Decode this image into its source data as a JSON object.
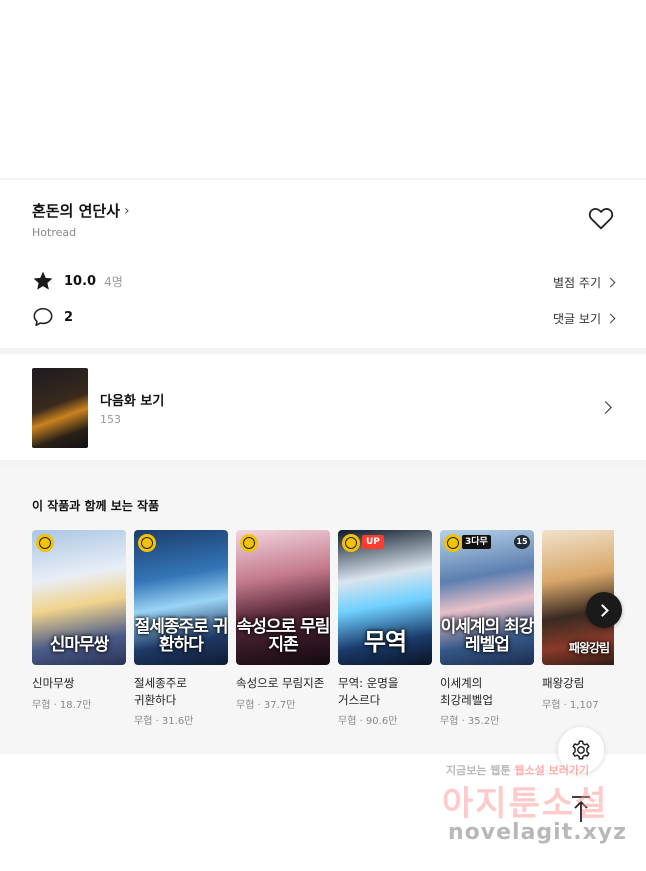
{
  "series": {
    "title": "혼돈의 연단사",
    "title_chevron": "›",
    "author": "Hotread",
    "rating_value": "10.0",
    "rating_count": "4명",
    "rate_link": "별점 주기",
    "comment_count": "2",
    "comments_link": "댓글 보기"
  },
  "next_episode": {
    "label": "다음화 보기",
    "number": "153"
  },
  "recommendations": {
    "title": "이 작품과 함께 보는 작품",
    "items": [
      {
        "name": "신마무쌍",
        "meta": "무협 · 18.7만",
        "cover_text": "신마무쌍",
        "badges": [
          "clock"
        ]
      },
      {
        "name": "절세종주로 귀환하다",
        "meta": "무협 · 31.6만",
        "cover_text": "절세종주로 귀환하다",
        "badges": [
          "clock"
        ]
      },
      {
        "name": "속성으로 무림지존",
        "meta": "무협 · 37.7만",
        "cover_text": "속성으로 무림지존",
        "badges": [
          "clock"
        ]
      },
      {
        "name": "무역: 운명을 거스르다",
        "meta": "무협 · 90.6만",
        "cover_text": "무역",
        "badges": [
          "clock",
          "UP"
        ]
      },
      {
        "name": "이세계의 최강레벨업",
        "meta": "무협 · 35.2만",
        "cover_text": "이세계의 최강레벨업",
        "badges": [
          "clock",
          "3다무",
          "15"
        ]
      },
      {
        "name": "패왕강림",
        "meta": "무협 · 1,107",
        "cover_text": "패왕강림",
        "badges": []
      }
    ]
  },
  "watermark": {
    "line1_a": "지금보는 웹툰",
    "line1_b": "웹소설",
    "line1_c": "보러가기",
    "logo": "아지툰소설",
    "url": "novelagit.xyz"
  },
  "colors": {
    "accent_badge": "#f2c300",
    "up_badge": "#ff3b30",
    "background_gray": "#f4f4f4"
  },
  "icons": {
    "heart": "heart-icon",
    "star": "star-icon",
    "comment": "comment-icon",
    "settings": "gear-icon",
    "scroll_top": "arrow-up-icon"
  }
}
